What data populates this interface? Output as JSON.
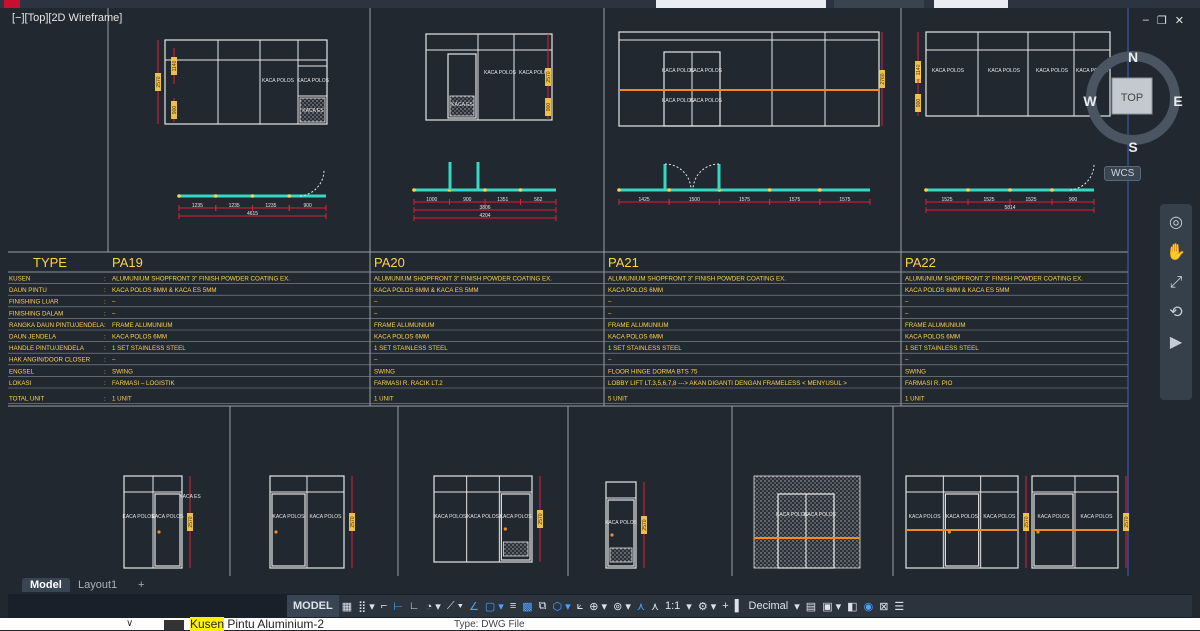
{
  "viewport": {
    "label": "[−][Top][2D Wireframe]",
    "window_buttons": [
      "–",
      "❐",
      "✕"
    ]
  },
  "viewcube": {
    "top": "TOP",
    "north": "N",
    "south": "S",
    "east": "E",
    "west": "W",
    "wcs": "WCS"
  },
  "table": {
    "type_header": "TYPE",
    "types": [
      "PA19",
      "PA20",
      "PA21",
      "PA22"
    ],
    "rows": [
      {
        "label": "KUSEN",
        "values": [
          "ALUMUNIUM SHOPFRONT 3\" FINISH POWDER COATING EX.",
          "ALUMUNIUM SHOPFRONT 3\" FINISH POWDER COATING EX.",
          "ALUMUNIUM SHOPFRONT 3\" FINISH POWDER COATING EX.",
          "ALUMUNIUM SHOPFRONT 3\" FINISH POWDER COATING EX."
        ]
      },
      {
        "label": "DAUN PINTU",
        "values": [
          "KACA POLOS 6MM & KACA ES 5MM",
          "KACA POLOS 6MM & KACA ES 5MM",
          "KACA POLOS 6MM",
          "KACA POLOS 6MM & KACA ES 5MM"
        ]
      },
      {
        "label": "FINISHING LUAR",
        "values": [
          "–",
          "–",
          "–",
          "–"
        ]
      },
      {
        "label": "FINISHING DALAM",
        "values": [
          "–",
          "–",
          "–",
          "–"
        ]
      },
      {
        "label": "RANGKA DAUN PINTU/JENDELA",
        "values": [
          "FRAME ALUMUNIUM",
          "FRAME ALUMUNIUM",
          "FRAME ALUMUNIUM",
          "FRAME ALUMUNIUM"
        ]
      },
      {
        "label": "DAUN JENDELA",
        "values": [
          "KACA POLOS 6MM",
          "KACA POLOS 6MM",
          "KACA POLOS 6MM",
          "KACA POLOS 6MM"
        ]
      },
      {
        "label": "HANDLE PINTU/JENDELA",
        "values": [
          "1 SET STAINLESS STEEL",
          "1 SET STAINLESS STEEL",
          "1 SET STAINLESS STEEL",
          "1 SET STAINLESS STEEL"
        ]
      },
      {
        "label": "HAK ANGIN/DOOR CLOSER",
        "values": [
          "–",
          "–",
          "–",
          "–"
        ]
      },
      {
        "label": "ENGSEL",
        "values": [
          "SWING",
          "SWING",
          "FLOOR HINGE DORMA BTS 75",
          "SWING"
        ]
      },
      {
        "label": "LOKASI",
        "values": [
          "FARMASI – LOGISTIK",
          "FARMASI R. RACIK LT.2",
          "LOBBY LIFT LT.3,5,6,7,8  ---> AKAN DIGANTI DENGAN FRAMELESS  < MENYUSUL >",
          "FARMASI R. PIO"
        ]
      },
      {
        "label": "TOTAL UNIT",
        "values": [
          "1 UNIT",
          "1 UNIT",
          "5 UNIT",
          "1 UNIT"
        ]
      }
    ]
  },
  "elevation_labels": {
    "kaca_polos": "KACA POLOS",
    "kaca_es": "KACA ES",
    "kaca_es_alt": "KACA ES"
  },
  "dims": {
    "pa19": {
      "h_total": "2570",
      "h_top": "1140",
      "h_low": "900",
      "plan_segments": [
        "1235",
        "1235",
        "1235",
        "900"
      ],
      "plan_total": "4615"
    },
    "pa20": {
      "h_total": "2570",
      "h_low": "900",
      "plan_segments": [
        "1000",
        "900",
        "1351",
        "562"
      ],
      "plan_sub": "3806",
      "plan_total": "4204"
    },
    "pa21": {
      "h_total": "2760",
      "h_top": "1140",
      "plan_segments": [
        "1425",
        "1500",
        "1575",
        "1575",
        "1575"
      ]
    },
    "pa22": {
      "h_total": "2570",
      "h_top": "1140",
      "h_low": "900",
      "plan_segments": [
        "1525",
        "1525",
        "1525",
        "900"
      ],
      "plan_total": "5814"
    }
  },
  "layout_tabs": {
    "model": "Model",
    "layout1": "Layout1",
    "add": "+"
  },
  "status_bar": {
    "model": "MODEL",
    "annotation_scale": "1:1",
    "units": "Decimal"
  },
  "page_below": {
    "filename_highlight": "Kusen",
    "filename_rest": " Pintu  Aluminium-2",
    "filetype": "Type: DWG File"
  },
  "colors": {
    "background": "#212830",
    "frame": "#e6e6e6",
    "dimension": "#e0203a",
    "text_yellow": "#ffd24d",
    "plan_cyan": "#34d9c3",
    "handle_orange": "#f08a24",
    "table_line": "#8a8f96"
  }
}
